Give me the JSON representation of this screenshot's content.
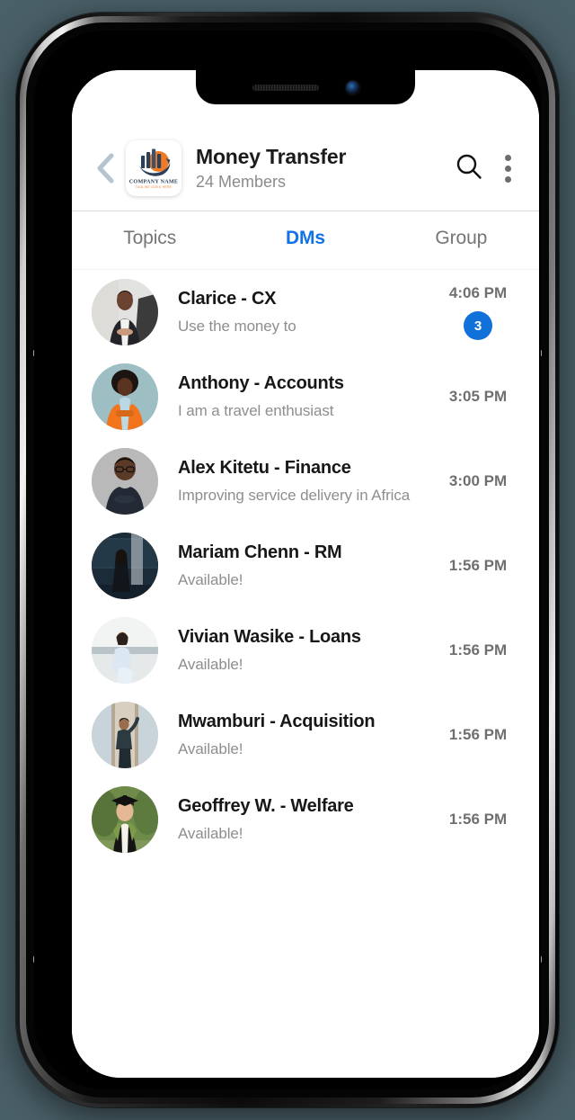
{
  "device": {
    "notch": {
      "speaker": "earpiece-speaker",
      "camera": "front-camera"
    },
    "buttons": [
      "mute-switch",
      "volume-up",
      "volume-down",
      "power"
    ]
  },
  "header": {
    "back_icon": "chevron-left-icon",
    "logo": {
      "name": "company-logo",
      "company_name": "COMPANY NAME",
      "tagline": "TAGLINE GOES HERE",
      "bar_color": "#2c4059",
      "accent_color": "#f07b26"
    },
    "title": "Money Transfer",
    "subtitle": "24 Members",
    "search_icon": "search-icon",
    "more_icon": "kebab-menu-icon"
  },
  "tabs": {
    "active_color": "#1273e6",
    "items": [
      {
        "label": "Topics",
        "active": false
      },
      {
        "label": "DMs",
        "active": true
      },
      {
        "label": "Group",
        "active": false
      }
    ]
  },
  "chats": [
    {
      "name": "Clarice - CX",
      "preview": "Use the money to",
      "time": "4:06 PM",
      "badge": "3",
      "avatar": "avatar-clarice"
    },
    {
      "name": "Anthony - Accounts",
      "preview": "I am a travel enthusiast",
      "time": "3:05 PM",
      "badge": "",
      "avatar": "avatar-anthony"
    },
    {
      "name": "Alex Kitetu - Finance",
      "preview": "Improving service delivery in Africa",
      "time": "3:00 PM",
      "badge": "",
      "avatar": "avatar-alex"
    },
    {
      "name": "Mariam Chenn - RM",
      "preview": "Available!",
      "time": "1:56 PM",
      "badge": "",
      "avatar": "avatar-mariam"
    },
    {
      "name": "Vivian Wasike - Loans",
      "preview": "Available!",
      "time": "1:56 PM",
      "badge": "",
      "avatar": "avatar-vivian"
    },
    {
      "name": "Mwamburi - Acquisition",
      "preview": "Available!",
      "time": "1:56 PM",
      "badge": "",
      "avatar": "avatar-mwamburi"
    },
    {
      "name": "Geoffrey W. - Welfare",
      "preview": "Available!",
      "time": "1:56 PM",
      "badge": "",
      "avatar": "avatar-geoffrey"
    }
  ]
}
